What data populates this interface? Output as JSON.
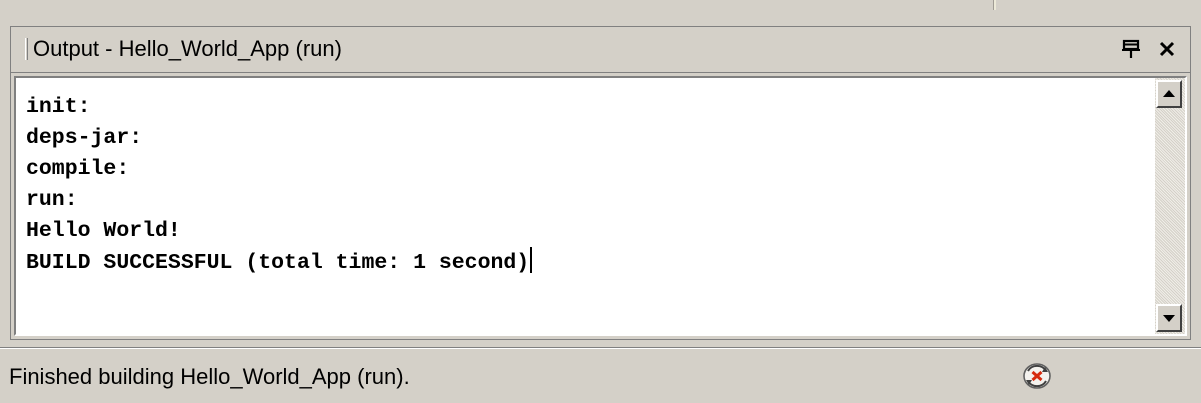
{
  "output_window": {
    "title": "Output - Hello_World_App (run)",
    "pin_icon": "pin-icon",
    "close_icon": "close-icon"
  },
  "console": {
    "lines": [
      "init:",
      "deps-jar:",
      "compile:",
      "run:",
      "Hello World!",
      "BUILD SUCCESSFUL (total time: 1 second)"
    ]
  },
  "scrollbar": {
    "up_icon": "scroll-up-arrow-icon",
    "down_icon": "scroll-down-arrow-icon"
  },
  "statusbar": {
    "text": "Finished building Hello_World_App (run).",
    "icon": "build-progress-icon"
  }
}
